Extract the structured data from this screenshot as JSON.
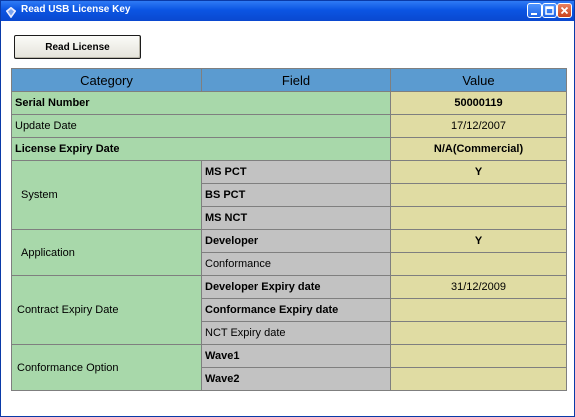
{
  "window": {
    "title": "Read USB License Key"
  },
  "toolbar": {
    "read_license_label": "Read License"
  },
  "table": {
    "headers": [
      "Category",
      "Field",
      "Value"
    ],
    "serial_number": {
      "label": "Serial Number",
      "value": "50000119"
    },
    "update_date": {
      "label": "Update Date",
      "value": "17/12/2007"
    },
    "license_expiry_date": {
      "label": "License Expiry Date",
      "value": "N/A(Commercial)"
    },
    "system": {
      "label": "System",
      "rows": [
        {
          "field": "MS PCT",
          "value": "Y"
        },
        {
          "field": "BS PCT",
          "value": ""
        },
        {
          "field": "MS NCT",
          "value": ""
        }
      ]
    },
    "application": {
      "label": "Application",
      "rows": [
        {
          "field": "Developer",
          "value": "Y"
        },
        {
          "field": "Conformance",
          "value": ""
        }
      ]
    },
    "contract_expiry": {
      "label": "Contract Expiry Date",
      "rows": [
        {
          "field": "Developer Expiry date",
          "value": "31/12/2009"
        },
        {
          "field": "Conformance Expiry date",
          "value": ""
        },
        {
          "field": "NCT Expiry date",
          "value": ""
        }
      ]
    },
    "conformance_option": {
      "label": "Conformance Option",
      "rows": [
        {
          "field": "Wave1",
          "value": ""
        },
        {
          "field": "Wave2",
          "value": ""
        }
      ]
    }
  },
  "colors": {
    "title_bar": "#0b55e3",
    "header_bg": "#5b9bd0",
    "category_bg": "#a8d8aa",
    "field_bg": "#c2c2c2",
    "value_bg": "#e0dca3"
  }
}
